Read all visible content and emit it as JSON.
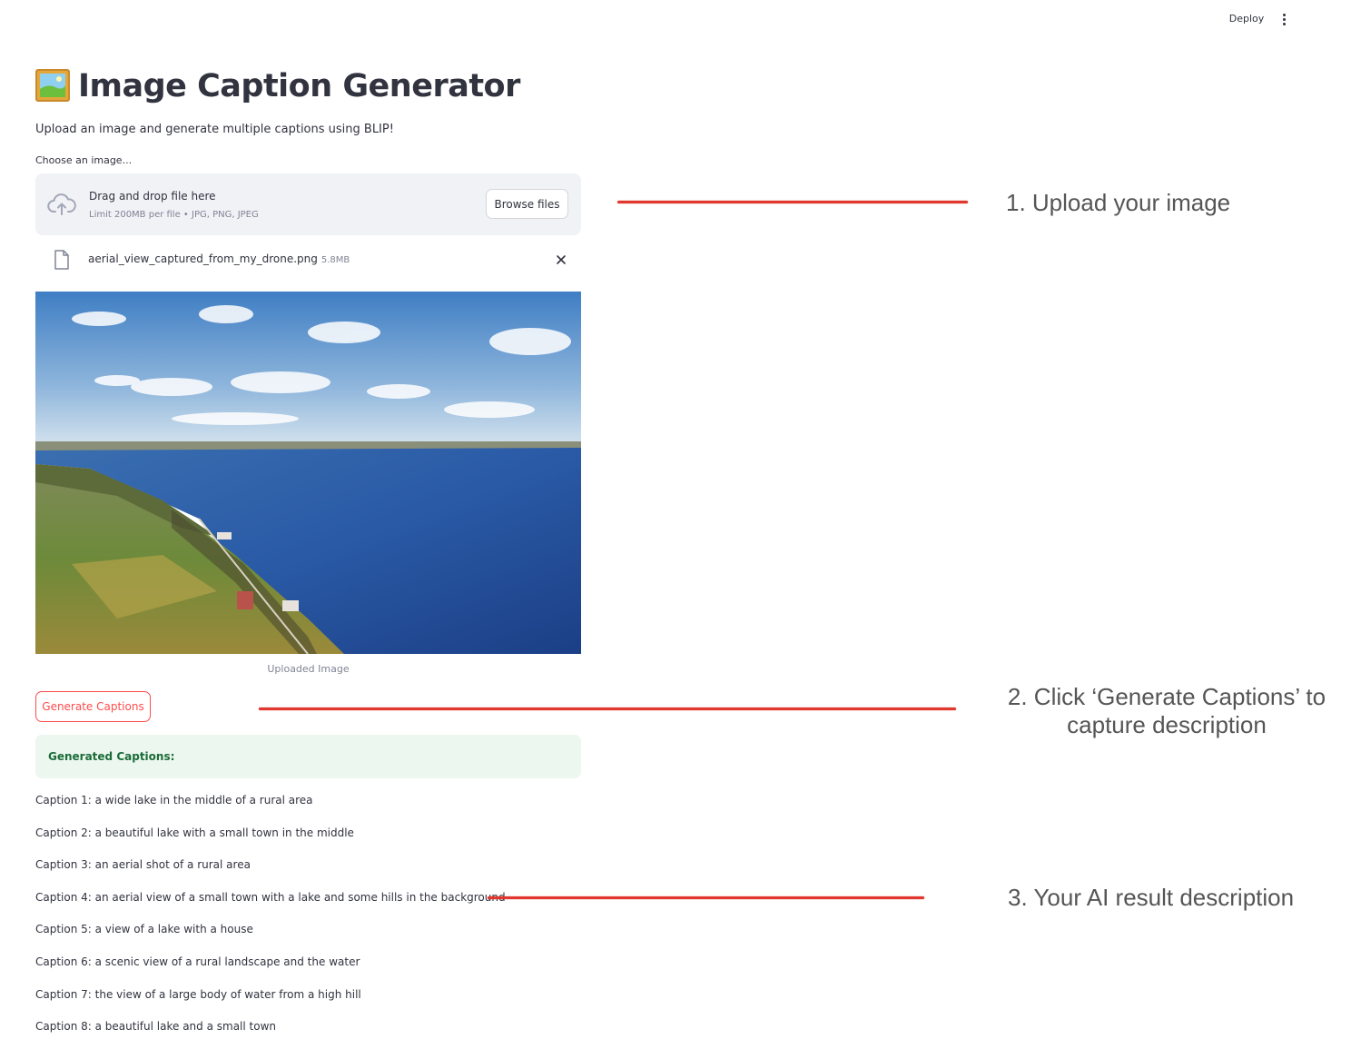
{
  "header": {
    "deploy_label": "Deploy",
    "menu_icon": "more-vertical-icon"
  },
  "page": {
    "title_icon": "framed-picture-icon",
    "title": "Image Caption Generator",
    "subtitle": "Upload an image and generate multiple captions using BLIP!"
  },
  "uploader": {
    "label": "Choose an image...",
    "icon": "cloud-upload-icon",
    "drop_text": "Drag and drop file here",
    "limit_text": "Limit 200MB per file • JPG, PNG, JPEG",
    "browse_label": "Browse files",
    "file": {
      "icon": "file-icon",
      "name": "aerial_view_captured_from_my_drone.png",
      "size": "5.8MB",
      "remove_icon": "close-icon"
    }
  },
  "image": {
    "caption": "Uploaded Image"
  },
  "generate_button_label": "Generate Captions",
  "success": {
    "text": "Generated Captions:"
  },
  "captions": [
    "Caption 1: a wide lake in the middle of a rural area",
    "Caption 2: a beautiful lake with a small town in the middle",
    "Caption 3: an aerial shot of a rural area",
    "Caption 4: an aerial view of a small town with a lake and some hills in the background",
    "Caption 5: a view of a lake with a house",
    "Caption 6: a scenic view of a rural landscape and the water",
    "Caption 7: the view of a large body of water from a high hill",
    "Caption 8: a beautiful lake and a small town"
  ],
  "annotations": {
    "step1": "1. Upload your image",
    "step2": "2. Click ‘Generate Captions’ to capture description",
    "step3": "3. Your AI result description"
  },
  "colors": {
    "primary": "#ff4b4b",
    "text": "#31333f",
    "muted": "#808495",
    "dropzone_bg": "#f0f2f6",
    "success_bg": "#ecf7ef",
    "success_text": "#1b6c38",
    "annotation_line": "#e0382e",
    "annotation_text": "#555555"
  }
}
